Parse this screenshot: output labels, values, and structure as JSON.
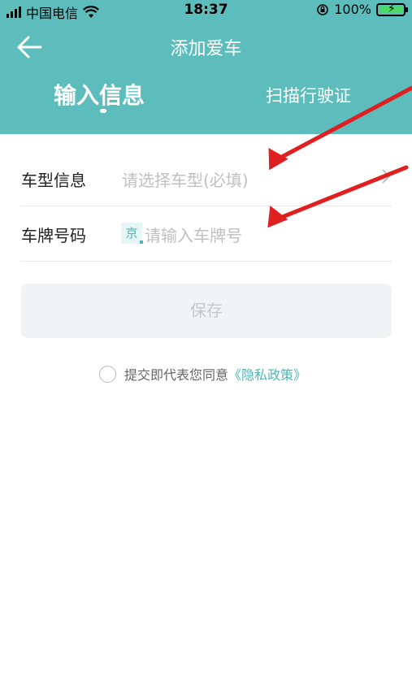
{
  "status_bar": {
    "carrier": "中国电信",
    "time": "18:37",
    "battery": "100%"
  },
  "header": {
    "title": "添加爱车",
    "tabs": [
      {
        "label": "输入信息",
        "active": true
      },
      {
        "label": "扫描行驶证",
        "active": false
      }
    ]
  },
  "form": {
    "model": {
      "label": "车型信息",
      "placeholder": "请选择车型(必填)"
    },
    "plate": {
      "label": "车牌号码",
      "prefix": "京",
      "placeholder": "请输入车牌号"
    }
  },
  "save_label": "保存",
  "agreement": {
    "text": "提交即代表您同意",
    "link": "《隐私政策》"
  },
  "colors": {
    "header_bg": "#5dbdbd",
    "accent": "#4cb6b6",
    "annotation": "#e02020"
  }
}
